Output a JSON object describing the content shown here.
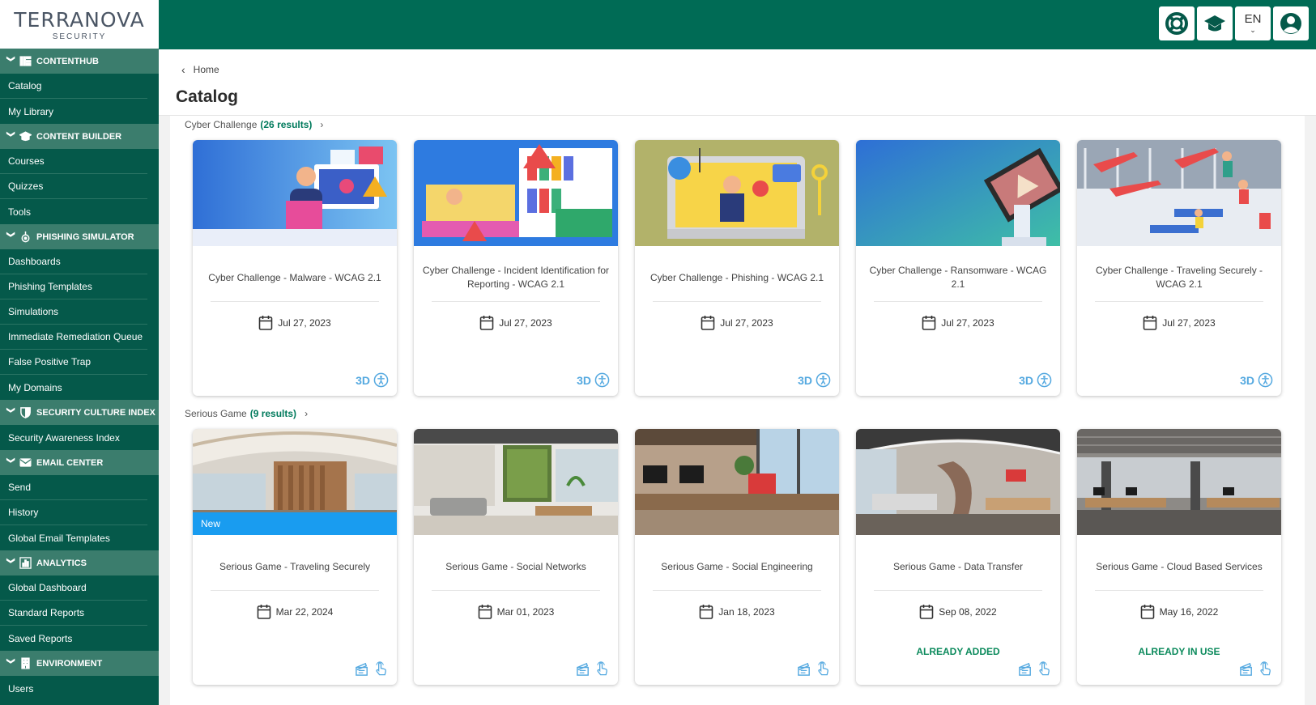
{
  "logo": {
    "brand": "TERRANOVA",
    "sub": "SECURITY"
  },
  "sidebar": {
    "sections": [
      {
        "title": "CONTENTHUB",
        "icon": "grid-bars-icon",
        "items": [
          "Catalog",
          "My Library"
        ]
      },
      {
        "title": "CONTENT BUILDER",
        "icon": "graduation-cap-icon",
        "items": [
          "Courses",
          "Quizzes",
          "Tools"
        ]
      },
      {
        "title": "PHISHING SIMULATOR",
        "icon": "phishing-hook-icon",
        "items": [
          "Dashboards",
          "Phishing Templates",
          "Simulations",
          "Immediate Remediation Queue",
          "False Positive Trap",
          "My Domains"
        ]
      },
      {
        "title": "SECURITY CULTURE INDEX",
        "icon": "shield-icon",
        "items": [
          "Security Awareness Index"
        ]
      },
      {
        "title": "EMAIL CENTER",
        "icon": "envelope-icon",
        "items": [
          "Send",
          "History",
          "Global Email Templates"
        ]
      },
      {
        "title": "ANALYTICS",
        "icon": "bar-chart-icon",
        "items": [
          "Global Dashboard",
          "Standard Reports",
          "Saved Reports"
        ]
      },
      {
        "title": "ENVIRONMENT",
        "icon": "building-icon",
        "items": [
          "Users"
        ]
      }
    ]
  },
  "topbar": {
    "language": "EN"
  },
  "breadcrumb": {
    "home": "Home"
  },
  "page": {
    "title": "Catalog"
  },
  "groups": [
    {
      "name": "Cyber Challenge",
      "count": "(26 results)",
      "cards": [
        {
          "title": "Cyber Challenge - Malware - WCAG 2.1",
          "date": "Jul 27, 2023",
          "tag": "3D",
          "status": "",
          "badge": "",
          "thumb": "malware"
        },
        {
          "title": "Cyber Challenge - Incident Identification for Reporting - WCAG 2.1",
          "date": "Jul 27, 2023",
          "tag": "3D",
          "status": "",
          "badge": "",
          "thumb": "incident"
        },
        {
          "title": "Cyber Challenge - Phishing - WCAG 2.1",
          "date": "Jul 27, 2023",
          "tag": "3D",
          "status": "",
          "badge": "",
          "thumb": "phishing"
        },
        {
          "title": "Cyber Challenge - Ransomware - WCAG 2.1",
          "date": "Jul 27, 2023",
          "tag": "3D",
          "status": "",
          "badge": "",
          "thumb": "ransomware"
        },
        {
          "title": "Cyber Challenge - Traveling Securely - WCAG 2.1",
          "date": "Jul 27, 2023",
          "tag": "3D",
          "status": "",
          "badge": "",
          "thumb": "airport"
        }
      ]
    },
    {
      "name": "Serious Game",
      "count": "(9 results)",
      "cards": [
        {
          "title": "Serious Game - Traveling Securely",
          "date": "Mar 22, 2024",
          "tag": "",
          "status": "",
          "badge": "New",
          "thumb": "office1"
        },
        {
          "title": "Serious Game - Social Networks",
          "date": "Mar 01, 2023",
          "tag": "",
          "status": "",
          "badge": "",
          "thumb": "office2"
        },
        {
          "title": "Serious Game - Social Engineering",
          "date": "Jan 18, 2023",
          "tag": "",
          "status": "",
          "badge": "",
          "thumb": "office3"
        },
        {
          "title": "Serious Game - Data Transfer",
          "date": "Sep 08, 2022",
          "tag": "",
          "status": "ALREADY ADDED",
          "badge": "",
          "thumb": "office4"
        },
        {
          "title": "Serious Game - Cloud Based Services",
          "date": "May 16, 2022",
          "tag": "",
          "status": "ALREADY IN USE",
          "badge": "",
          "thumb": "office5"
        }
      ]
    }
  ],
  "colors": {
    "sidebar": "#05594a",
    "section_header": "#3b7d6d",
    "topbar": "#006b55",
    "accent_green": "#007a5c",
    "icon_blue": "#55a9e0",
    "new_badge": "#199cf0"
  }
}
